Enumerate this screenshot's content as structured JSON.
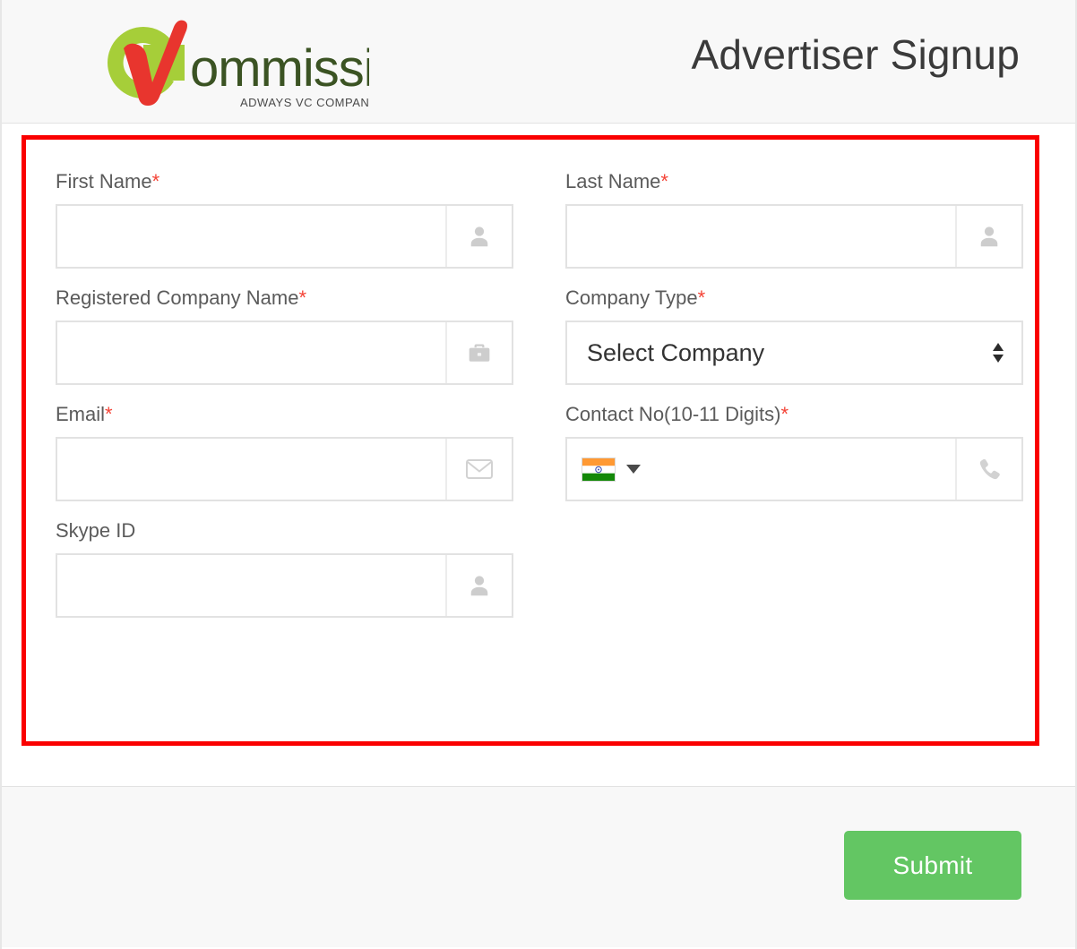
{
  "header": {
    "title": "Advertiser Signup",
    "logo": {
      "brand_text": "ommission",
      "tagline": "ADWAYS VC COMPANY",
      "circle_color": "#a6ce39",
      "check_color": "#e8352e",
      "text_color": "#3b5323"
    }
  },
  "form": {
    "rows": [
      {
        "left": {
          "label": "First Name",
          "required": true,
          "required_mark": "*",
          "value": "",
          "placeholder": "",
          "icon": "user-icon",
          "type": "text"
        },
        "right": {
          "label": "Last Name",
          "required": true,
          "required_mark": "*",
          "value": "",
          "placeholder": "",
          "icon": "user-icon",
          "type": "text"
        }
      },
      {
        "left": {
          "label": "Registered Company Name",
          "required": true,
          "required_mark": "*",
          "value": "",
          "placeholder": "",
          "icon": "briefcase-icon",
          "type": "text"
        },
        "right": {
          "label": "Company Type",
          "required": true,
          "required_mark": "*",
          "selected_option": "Select Company",
          "icon": "updown-arrows-icon",
          "type": "select"
        }
      },
      {
        "left": {
          "label": "Email",
          "required": true,
          "required_mark": "*",
          "value": "",
          "placeholder": "",
          "icon": "envelope-icon",
          "type": "text"
        },
        "right": {
          "label": "Contact No(10-11 Digits)",
          "required": true,
          "required_mark": "*",
          "value": "",
          "placeholder": "",
          "icon": "phone-icon",
          "country_flag": "india-flag-icon",
          "country_caret": "caret-down-icon",
          "type": "tel"
        }
      },
      {
        "left": {
          "label": "Skype ID",
          "required": false,
          "required_mark": "",
          "value": "",
          "placeholder": "",
          "icon": "user-icon",
          "type": "text"
        },
        "right": null
      }
    ]
  },
  "footer": {
    "submit_label": "Submit"
  },
  "colors": {
    "highlight_border": "#fa0000",
    "submit_green": "#63c663",
    "required_red": "#f44336",
    "label_gray": "#5b5b5b",
    "field_border": "#e2e2e2",
    "panel_gray": "#f8f8f8",
    "flag_saffron": "#ff9933",
    "flag_green": "#138808",
    "flag_chakra": "#3f51b5"
  }
}
